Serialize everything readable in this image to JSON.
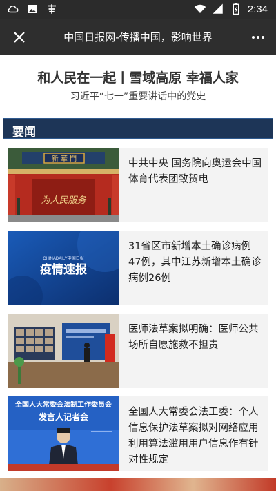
{
  "status_bar": {
    "time": "2:34",
    "icons": [
      "cloud-icon",
      "image-icon",
      "app-icon",
      "wifi-icon",
      "signal-icon",
      "battery-icon"
    ],
    "bg": "#2b2b2b"
  },
  "title_bar": {
    "title": "中国日报网-传播中国，影响世界",
    "close_icon": "close-icon",
    "more_icon": "more-icon"
  },
  "banner": {
    "headline": "和人民在一起丨雪域高原 幸福人家",
    "subline": "习近平“七一”重要讲话中的党史"
  },
  "section": {
    "label": "要闻",
    "color": "#1d3557"
  },
  "news": [
    {
      "title": "中共中央 国务院向奥运会中国体育代表团致贺电",
      "thumb_gate_text": "新 華 門",
      "thumb_wall_text": "为人民服务"
    },
    {
      "title": "31省区市新增本土确诊病例47例，其中江苏新增本土确诊病例26例",
      "thumb_brand": "CHINADAILY中国日报",
      "thumb_text": "疫情速报"
    },
    {
      "title": "医师法草案拟明确：医师公共场所自愿施救不担责"
    },
    {
      "title": "全国人大常委会法工委：个人信息保护法草案拟对网络应用利用算法滥用用户信息作有针对性规定",
      "thumb_line1": "全国人大常委会法制工作委员会",
      "thumb_line2": "发言人记者会"
    }
  ]
}
